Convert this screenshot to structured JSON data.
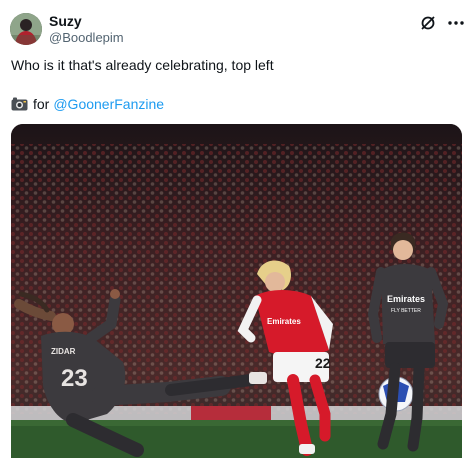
{
  "author": {
    "name": "Suzy",
    "handle": "@Boodlepim",
    "avatar_icon": "avatar-photo"
  },
  "header_actions": {
    "grok_icon": "grok-icon",
    "more_icon": "more-icon"
  },
  "tweet": {
    "text": "Who is it that's already celebrating, top left",
    "credit_prefix": "for",
    "credit_link": "@GoonerFanzine",
    "camera_icon": "camera-icon"
  },
  "media": {
    "player_left_number": "23",
    "player_left_name": "ZIDAR",
    "player_center_number": "22",
    "player_center_sponsor": "Emirates",
    "player_right_sponsor": "Emirates",
    "player_right_sponsor_sub": "FLY BETTER",
    "colors": {
      "arsenal_red": "#d61a2a",
      "real_dark": "#3c3a3e",
      "pitch": "#2f5a2c",
      "crowd": "#3a1f22"
    }
  }
}
